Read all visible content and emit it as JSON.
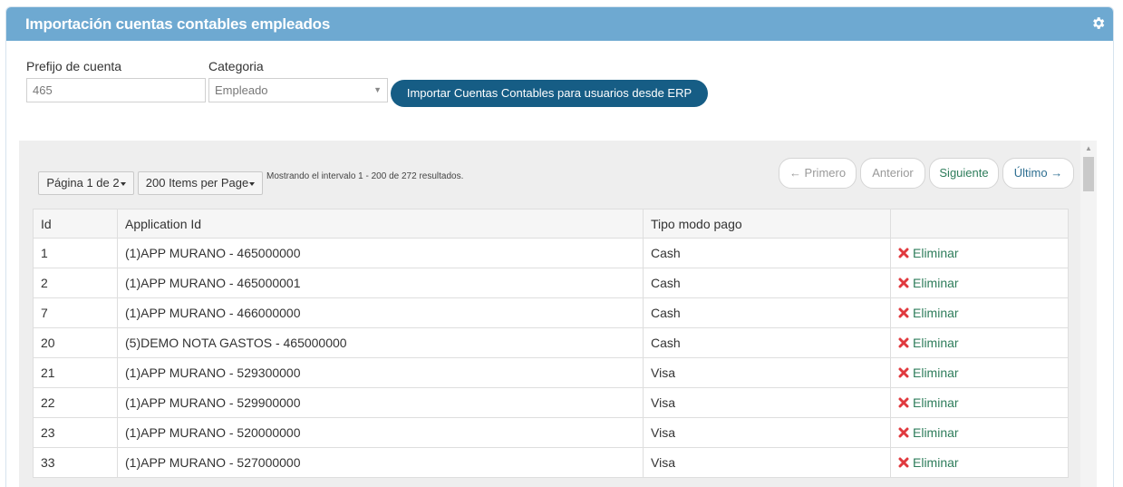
{
  "panel": {
    "title": "Importación cuentas contables empleados",
    "icon": "gear-icon"
  },
  "form": {
    "prefix_label": "Prefijo de cuenta",
    "prefix_value": "465",
    "category_label": "Categoria",
    "category_value": "Empleado",
    "import_button": "Importar Cuentas Contables para usuarios desde ERP"
  },
  "grid": {
    "page_selector": "Página 1 de 2",
    "items_selector": "200 Items per Page",
    "range_text": "Mostrando el intervalo 1 - 200 de 272 resultados.",
    "pager": {
      "first": "← Primero",
      "prev": "Anterior",
      "next": "Siguiente",
      "last": "Último →"
    },
    "columns": [
      "Id",
      "Application Id",
      "Tipo modo pago",
      ""
    ],
    "delete_label": "Eliminar",
    "rows": [
      {
        "id": "1",
        "app": "(1)APP MURANO - 465000000",
        "pago": "Cash"
      },
      {
        "id": "2",
        "app": "(1)APP MURANO - 465000001",
        "pago": "Cash"
      },
      {
        "id": "7",
        "app": "(1)APP MURANO - 466000000",
        "pago": "Cash"
      },
      {
        "id": "20",
        "app": "(5)DEMO NOTA GASTOS - 465000000",
        "pago": "Cash"
      },
      {
        "id": "21",
        "app": "(1)APP MURANO - 529300000",
        "pago": "Visa"
      },
      {
        "id": "22",
        "app": "(1)APP MURANO - 529900000",
        "pago": "Visa"
      },
      {
        "id": "23",
        "app": "(1)APP MURANO - 520000000",
        "pago": "Visa"
      },
      {
        "id": "33",
        "app": "(1)APP MURANO - 527000000",
        "pago": "Visa"
      }
    ]
  },
  "colors": {
    "header": "#6ea9d1",
    "button": "#165d85",
    "delete": "#2e7d5b",
    "delete_icon": "#e0393e"
  }
}
